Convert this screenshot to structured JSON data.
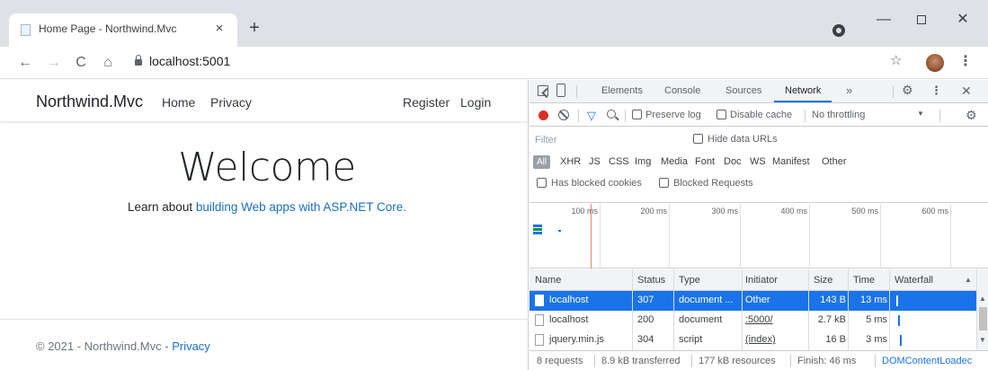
{
  "browser": {
    "tab_title": "Home Page - Northwind.Mvc",
    "tab_close": "×",
    "new_tab": "+",
    "url": "localhost:5001",
    "window_controls": {
      "minimize": "—",
      "maximize": "",
      "close": "✕"
    },
    "nav": {
      "back": "←",
      "forward": "→",
      "reload": "C",
      "home": "⌂",
      "bookmark": "☆",
      "menu": "⋮"
    }
  },
  "site": {
    "brand": "Northwind.Mvc",
    "nav_links": {
      "home": "Home",
      "privacy": "Privacy",
      "register": "Register",
      "login": "Login"
    },
    "heading": "Welcome",
    "learn_prefix": "Learn about ",
    "learn_link": "building Web apps with ASP.NET Core.",
    "footer_prefix": "© 2021 - Northwind.Mvc - ",
    "footer_link": "Privacy"
  },
  "devtools": {
    "tabs": [
      "Elements",
      "Console",
      "Sources",
      "Network"
    ],
    "active_tab": "Network",
    "more_tabs": "»",
    "preserve_log": "Preserve log",
    "disable_cache": "Disable cache",
    "throttling": "No throttling",
    "filter_placeholder": "Filter",
    "hide_data_urls": "Hide data URLs",
    "resource_types": [
      "All",
      "XHR",
      "JS",
      "CSS",
      "Img",
      "Media",
      "Font",
      "Doc",
      "WS",
      "Manifest",
      "Other"
    ],
    "has_blocked_cookies": "Has blocked cookies",
    "blocked_requests": "Blocked Requests",
    "timeline_ticks": [
      "100 ms",
      "200 ms",
      "300 ms",
      "400 ms",
      "500 ms",
      "600 ms"
    ],
    "columns": {
      "name": "Name",
      "status": "Status",
      "type": "Type",
      "initiator": "Initiator",
      "size": "Size",
      "time": "Time",
      "waterfall": "Waterfall"
    },
    "requests": [
      {
        "name": "localhost",
        "status": "307",
        "type": "document ...",
        "initiator": "Other",
        "size": "143 B",
        "time": "13 ms"
      },
      {
        "name": "localhost",
        "status": "200",
        "type": "document",
        "initiator": ":5000/",
        "size": "2.7 kB",
        "time": "5 ms"
      },
      {
        "name": "jquery.min.js",
        "status": "304",
        "type": "script",
        "initiator": "(index)",
        "size": "16 B",
        "time": "3 ms"
      }
    ],
    "status_bar": {
      "requests": "8 requests",
      "transferred": "8.9 kB transferred",
      "resources": "177 kB resources",
      "finish": "Finish: 46 ms",
      "dcl": "DOMContentLoadec"
    }
  },
  "colors": {
    "accent": "#1a73e8",
    "record": "#d93025",
    "link": "#1b6ec2"
  }
}
